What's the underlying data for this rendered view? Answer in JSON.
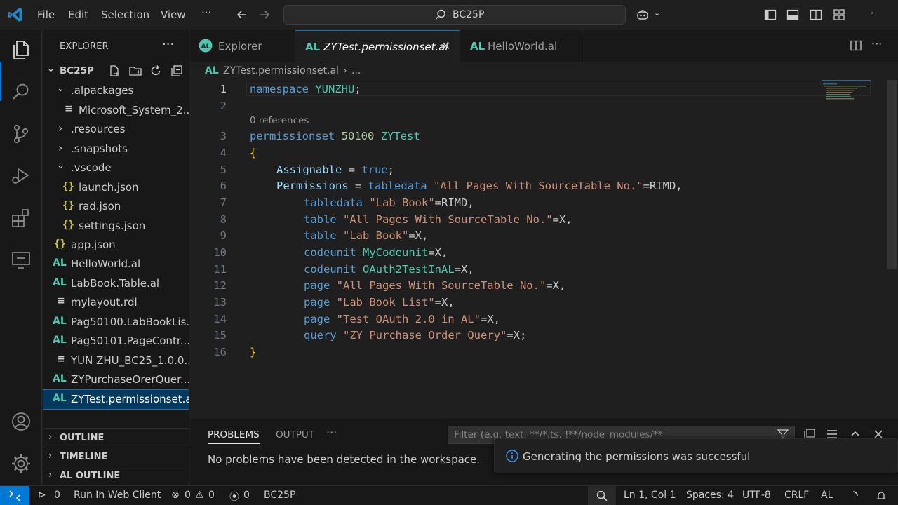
{
  "titlebar": {
    "menu": [
      "File",
      "Edit",
      "Selection",
      "View"
    ],
    "more": "···",
    "command_center": "BC25P"
  },
  "explorer": {
    "header": "EXPLORER",
    "more": "···",
    "root": "BC25P",
    "items": [
      {
        "label": ".alpackages",
        "chev": "⌄"
      },
      {
        "label": "Microsoft_System_2..."
      },
      {
        "label": ".resources",
        "chev": "›"
      },
      {
        "label": ".snapshots",
        "chev": "›"
      },
      {
        "label": ".vscode",
        "chev": "⌄"
      },
      {
        "label": "launch.json",
        "icon": "{}"
      },
      {
        "label": "rad.json",
        "icon": "{}"
      },
      {
        "label": "settings.json",
        "icon": "{}"
      },
      {
        "label": "app.json",
        "icon": "{}"
      },
      {
        "label": "HelloWorld.al",
        "icon": "AL"
      },
      {
        "label": "LabBook.Table.al",
        "icon": "AL"
      },
      {
        "label": "mylayout.rdl"
      },
      {
        "label": "Pag50100.LabBookLis...",
        "icon": "AL"
      },
      {
        "label": "Pag50101.PageContr...",
        "icon": "AL"
      },
      {
        "label": "YUN ZHU_BC25_1.0.0...."
      },
      {
        "label": "ZYPurchaseOrerQuer...",
        "icon": "AL"
      },
      {
        "label": "ZYTest.permissionset.al",
        "icon": "AL"
      }
    ],
    "sections": [
      "OUTLINE",
      "TIMELINE",
      "AL OUTLINE"
    ]
  },
  "tabs": [
    {
      "icon": "AL",
      "label": "Explorer"
    },
    {
      "icon": "AL",
      "label": "ZYTest.permissionset.al",
      "close": "✕"
    },
    {
      "icon": "AL",
      "label": "HelloWorld.al"
    }
  ],
  "breadcrumb": {
    "icon": "AL",
    "file": "ZYTest.permissionset.al",
    "sep": "›",
    "more": "..."
  },
  "editor": {
    "codelens": "0 references",
    "line_numbers": [
      "1",
      "2",
      "3",
      "4",
      "5",
      "6",
      "7",
      "8",
      "9",
      "10",
      "11",
      "12",
      "13",
      "14",
      "15",
      "16"
    ],
    "line1": {
      "k": "namespace",
      "v": "YUNZHU",
      "p": ";"
    },
    "line3": {
      "k": "permissionset",
      "n": "50100",
      "v": "ZYTest"
    },
    "open_brace": "{",
    "close_brace": "}",
    "line5": {
      "prop": "Assignable",
      "eq": " = ",
      "val": "true",
      "end": ";"
    },
    "line6": {
      "prop": "Permissions",
      "eq": " = ",
      "obj": "tabledata",
      "str": "\"All Pages With SourceTable No.\"",
      "rest": "=RIMD,"
    },
    "perm_lines": [
      {
        "obj": "tabledata",
        "str": "\"Lab Book\"",
        "rest": "=RIMD,"
      },
      {
        "obj": "table",
        "str": "\"All Pages With SourceTable No.\"",
        "rest": "=X,"
      },
      {
        "obj": "table",
        "str": "\"Lab Book\"",
        "rest": "=X,"
      },
      {
        "obj": "codeunit",
        "id": "MyCodeunit",
        "rest": "=X,"
      },
      {
        "obj": "codeunit",
        "id": "OAuth2TestInAL",
        "rest": "=X,"
      },
      {
        "obj": "page",
        "str": "\"All Pages With SourceTable No.\"",
        "rest": "=X,"
      },
      {
        "obj": "page",
        "str": "\"Lab Book List\"",
        "rest": "=X,"
      },
      {
        "obj": "page",
        "str": "\"Test OAuth 2.0 in AL\"",
        "rest": "=X,"
      },
      {
        "obj": "query",
        "str": "\"ZY Purchase Order Query\"",
        "rest": "=X;"
      }
    ]
  },
  "panel": {
    "tabs": [
      "PROBLEMS",
      "OUTPUT"
    ],
    "more": "···",
    "filter_placeholder": "Filter (e.g. text, **/*.ts, !**/node_modules/**)",
    "message": "No problems have been detected in the workspace."
  },
  "notification": {
    "message": "Generating the permissions was successful"
  },
  "statusbar": {
    "ports": "0",
    "run": "Run In Web Client",
    "errors": "0",
    "warnings": "0",
    "radio": "0",
    "workspace": "BC25P",
    "position": "Ln 1, Col 1",
    "spaces": "Spaces: 4",
    "encoding": "UTF-8",
    "eol": "CRLF",
    "language": "AL"
  },
  "colors": {
    "accent": "#0078d4",
    "keyword": "#569cd6",
    "type": "#4ec9b0",
    "string": "#ce9178",
    "number": "#b5cea8",
    "property": "#9cdcfe"
  }
}
